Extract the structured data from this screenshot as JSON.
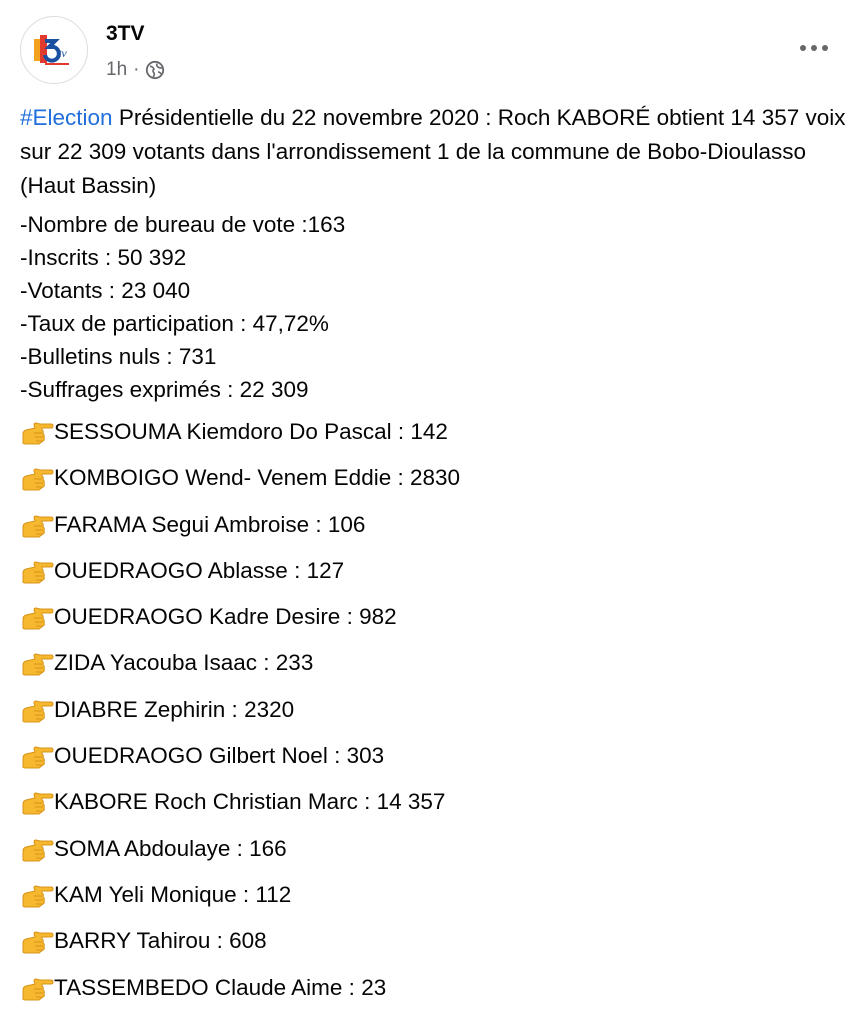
{
  "post": {
    "page_name": "3TV",
    "time": "1h",
    "separator": "·",
    "hashtag": "#Election",
    "intro_text": " Présidentielle du 22 novembre 2020 : Roch KABORÉ obtient 14 357 voix sur 22 309 votants dans l'arrondissement 1 de la commune de Bobo-Dioulasso (Haut Bassin)",
    "stats": [
      "-Nombre de bureau de vote :163",
      "-Inscrits : 50 392",
      "-Votants : 23 040",
      "-Taux de participation : 47,72%",
      "-Bulletins nuls : 731",
      "-Suffrages exprimés : 22 309"
    ],
    "candidates": [
      "SESSOUMA Kiemdoro Do Pascal : 142",
      "KOMBOIGO Wend- Venem Eddie : 2830",
      "FARAMA Segui Ambroise : 106",
      "OUEDRAOGO Ablasse : 127",
      "OUEDRAOGO Kadre Desire : 982",
      "ZIDA Yacouba Isaac : 233",
      "DIABRE Zephirin : 2320",
      "OUEDRAOGO Gilbert Noel : 303",
      "KABORE Roch Christian Marc : 14 357",
      "SOMA Abdoulaye : 166",
      "KAM Yeli Monique : 112",
      "BARRY Tahirou : 608",
      "TASSEMBEDO Claude Aime : 23"
    ],
    "icons": {
      "avatar": "3tv-logo",
      "audience": "globe-icon",
      "more": "more-options-icon",
      "bullet": "pointing-hand-icon"
    },
    "colors": {
      "hashtag": "#216fdb",
      "meta": "#65676b",
      "text": "#050505",
      "hand": "#f5b82e"
    }
  }
}
